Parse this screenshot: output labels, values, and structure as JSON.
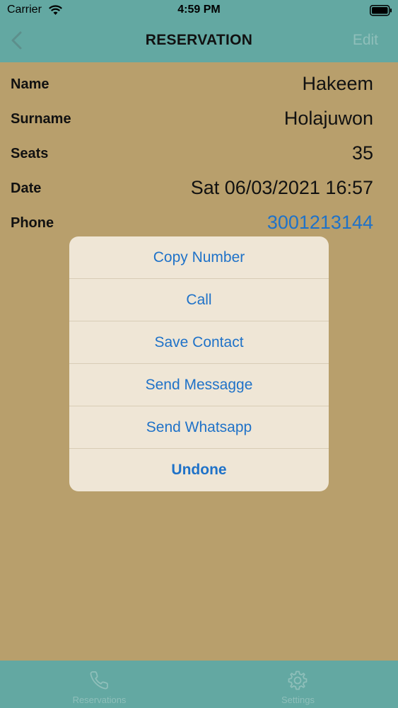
{
  "status_bar": {
    "carrier": "Carrier",
    "time": "4:59 PM"
  },
  "nav": {
    "title": "RESERVATION",
    "edit_label": "Edit"
  },
  "details": [
    {
      "label": "Name",
      "value": "Hakeem"
    },
    {
      "label": "Surname",
      "value": "Holajuwon"
    },
    {
      "label": "Seats",
      "value": "35"
    },
    {
      "label": "Date",
      "value": "Sat 06/03/2021 16:57"
    },
    {
      "label": "Phone",
      "value": "3001213144"
    }
  ],
  "action_sheet": {
    "items": [
      "Copy Number",
      "Call",
      "Save Contact",
      "Send Messagge",
      "Send Whatsapp",
      "Undone"
    ]
  },
  "tabs": [
    {
      "label": "Reservations",
      "icon": "phone-icon"
    },
    {
      "label": "Settings",
      "icon": "gear-icon"
    }
  ],
  "colors": {
    "header": "#63a8a2",
    "background": "#b89f6c",
    "sheet": "#efe6d6",
    "link": "#1f72c8"
  }
}
